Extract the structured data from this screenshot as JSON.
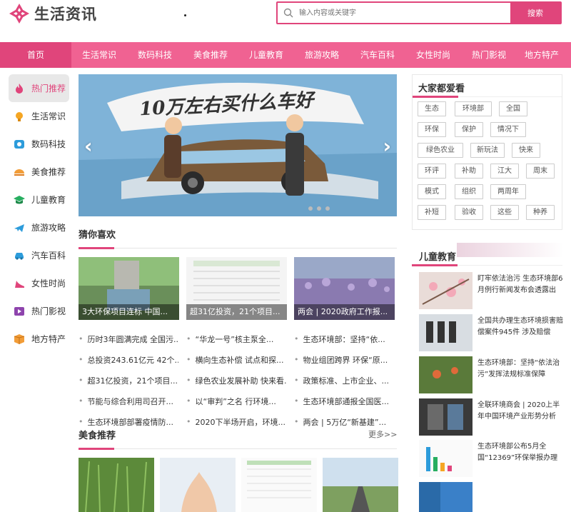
{
  "header": {
    "logo_text": "生活资讯",
    "search_placeholder": "输入内容或关键字",
    "search_button": "搜索"
  },
  "nav": {
    "items": [
      "首页",
      "生活常识",
      "数码科技",
      "美食推荐",
      "儿童教育",
      "旅游攻略",
      "汽车百科",
      "女性时尚",
      "热门影视",
      "地方特产"
    ]
  },
  "sidebar": {
    "items": [
      {
        "label": "热门推荐",
        "icon": "fire-icon"
      },
      {
        "label": "生活常识",
        "icon": "bulb-icon"
      },
      {
        "label": "数码科技",
        "icon": "camera-icon"
      },
      {
        "label": "美食推荐",
        "icon": "food-icon"
      },
      {
        "label": "儿童教育",
        "icon": "graduation-icon"
      },
      {
        "label": "旅游攻略",
        "icon": "plane-icon"
      },
      {
        "label": "汽车百科",
        "icon": "car-icon"
      },
      {
        "label": "女性时尚",
        "icon": "heel-icon"
      },
      {
        "label": "热门影视",
        "icon": "video-icon"
      },
      {
        "label": "地方特产",
        "icon": "box-icon"
      }
    ]
  },
  "banner": {
    "headline": "10万左右买什么车好"
  },
  "guess": {
    "title": "猜你喜欢",
    "cards": [
      "3大环保项目连标 中国...",
      "超31亿投资，21个项目...",
      "两会 | 2020政府工作报..."
    ],
    "columns": [
      [
        "历时3年圆满完成 全国污...",
        "总投资243.61亿元 42个...",
        "超31亿投资，21个项目...",
        "节能与综合利用司召开...",
        "生态环境部部署疫情防..."
      ],
      [
        "“华龙一号”核主泵全...",
        "横向生态补偿 试点和探...",
        "绿色农业发展补助 快来看...",
        "以“审判”之名 行环境...",
        "2020下半场开启，环境..."
      ],
      [
        "生态环境部：坚持“依...",
        "物业组团跨界 环保“原...",
        "政策标准、上市企业、...",
        "生态环境部通报全国医...",
        "两会 | 5万亿“新基建”..."
      ]
    ]
  },
  "food": {
    "title": "美食推荐",
    "more": "更多>>"
  },
  "popular": {
    "title": "大家都爱看",
    "tags": [
      "生态",
      "环境部",
      "全国",
      "环保",
      "保护",
      "情况下",
      "绿色农业",
      "新玩法",
      "快来",
      "环评",
      "补助",
      "江大",
      "周末",
      "模式",
      "组织",
      "两周年",
      "补短",
      "验收",
      "这些",
      "种养"
    ]
  },
  "kids": {
    "title": "儿童教育",
    "items": [
      "盯牢依法治污 生态环境部6月例行新闻发布会透露出",
      "全国共办理生态环境损害赔偿案件945件 涉及赔偿",
      "生态环境部：坚持“依法治污”发挥法规标准保障",
      "全联环境商会 | 2020上半年中国环境产业形势分析",
      "生态环境部公布5月全国“12369”环保举报办理"
    ]
  },
  "colors": {
    "accent": "#e0457b",
    "nav": "#f06292"
  }
}
